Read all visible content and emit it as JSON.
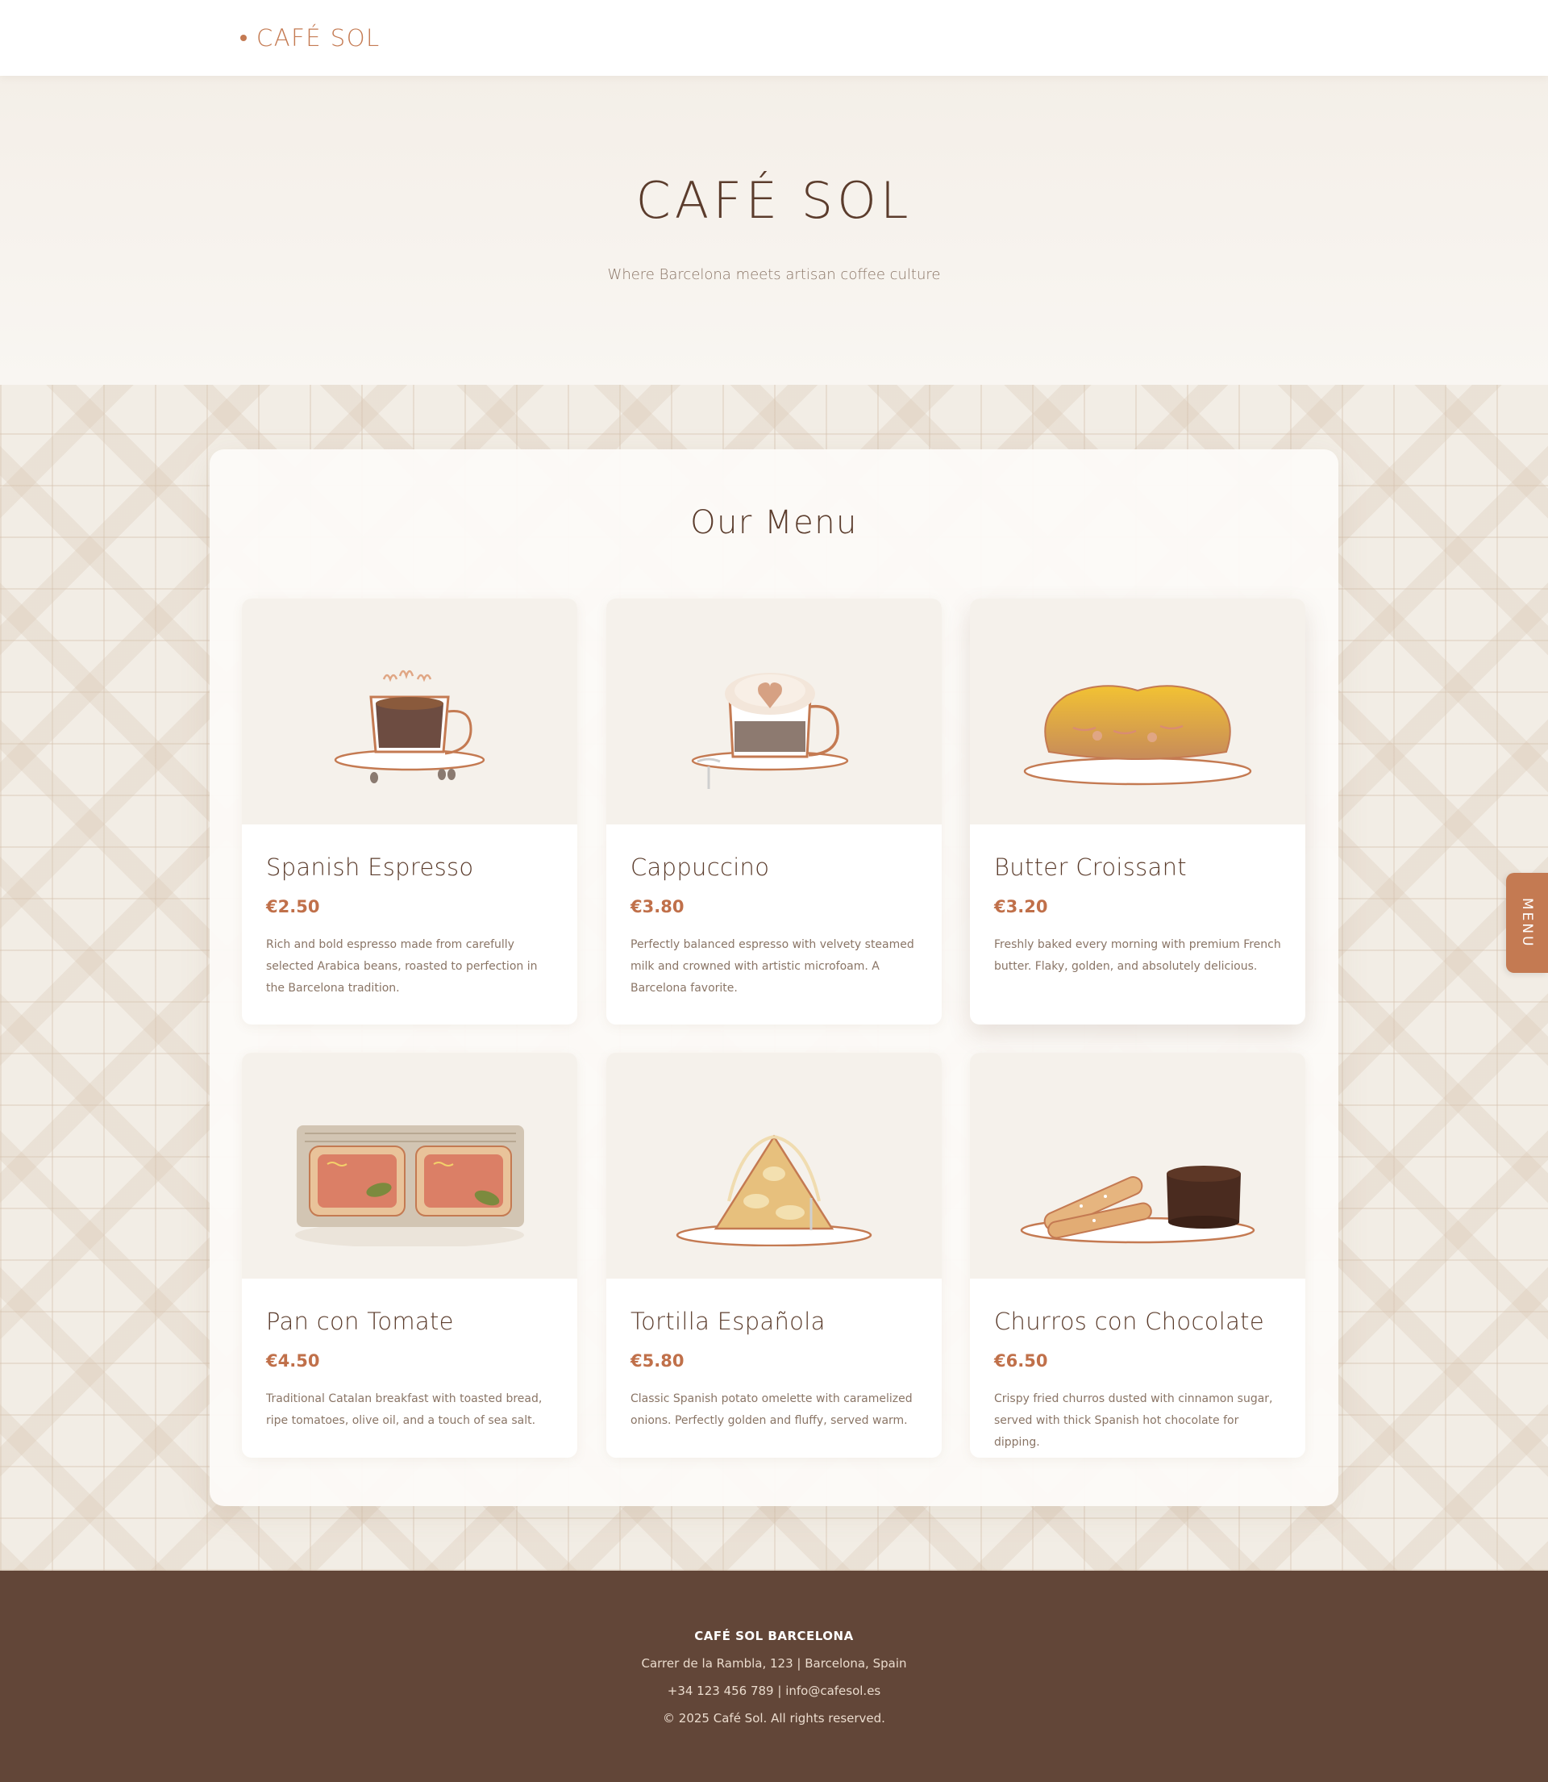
{
  "header": {
    "logo_text": "CAFÉ SOL"
  },
  "hero": {
    "title": "CAFÉ SOL",
    "subtitle": "Where Barcelona meets artisan coffee culture"
  },
  "menu": {
    "title": "Our Menu",
    "items": [
      {
        "name": "Spanish Espresso",
        "price": "€2.50",
        "description": "Rich and bold espresso made from carefully selected Arabica beans, roasted to perfection in the Barcelona tradition.",
        "image_icon": "espresso-cup-icon"
      },
      {
        "name": "Cappuccino",
        "price": "€3.80",
        "description": "Perfectly balanced espresso with velvety steamed milk and crowned with artistic microfoam. A Barcelona favorite.",
        "image_icon": "cappuccino-cup-icon"
      },
      {
        "name": "Butter Croissant",
        "price": "€3.20",
        "description": "Freshly baked every morning with premium French butter. Flaky, golden, and absolutely delicious.",
        "image_icon": "croissant-icon"
      },
      {
        "name": "Pan con Tomate",
        "price": "€4.50",
        "description": "Traditional Catalan breakfast with toasted bread, ripe tomatoes, olive oil, and a touch of sea salt.",
        "image_icon": "pan-con-tomate-icon"
      },
      {
        "name": "Tortilla Española",
        "price": "€5.80",
        "description": "Classic Spanish potato omelette with caramelized onions. Perfectly golden and fluffy, served warm.",
        "image_icon": "tortilla-slice-icon"
      },
      {
        "name": "Churros con Chocolate",
        "price": "€6.50",
        "description": "Crispy fried churros dusted with cinnamon sugar, served with thick Spanish hot chocolate for dipping.",
        "image_icon": "churros-chocolate-icon"
      }
    ]
  },
  "side_tab": {
    "label": "MENU"
  },
  "footer": {
    "title": "CAFÉ SOL BARCELONA",
    "address": "Carrer de la Rambla, 123 | Barcelona, Spain",
    "contact": "+34 123 456 789 | info@cafesol.es",
    "copyright": "© 2025 Café Sol. All rights reserved."
  },
  "colors": {
    "accent": "#c47a52",
    "dark_brown": "#5b3c2c",
    "footer_bg": "#624638",
    "card_image_bg": "#f5f1eb"
  }
}
